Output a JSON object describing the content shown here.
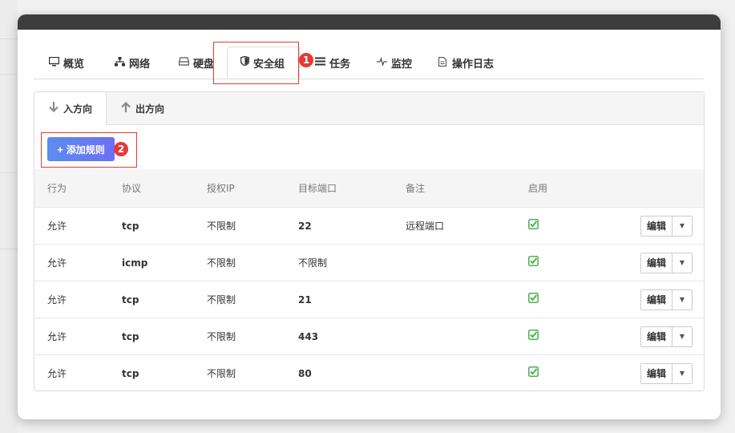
{
  "tabs": [
    {
      "label": "概览",
      "icon": "monitor-icon"
    },
    {
      "label": "网络",
      "icon": "network-icon"
    },
    {
      "label": "硬盘",
      "icon": "disk-icon"
    },
    {
      "label": "安全组",
      "icon": "shield-icon"
    },
    {
      "label": "任务",
      "icon": "list-icon"
    },
    {
      "label": "监控",
      "icon": "pulse-icon"
    },
    {
      "label": "操作日志",
      "icon": "document-icon"
    }
  ],
  "active_tab": "安全组",
  "annotations": {
    "first": "1",
    "second": "2"
  },
  "subtabs": [
    {
      "label": "入方向",
      "icon": "arrow-down-icon"
    },
    {
      "label": "出方向",
      "icon": "arrow-up-icon"
    }
  ],
  "add_rule_label": "添加规则",
  "table": {
    "headers": [
      "行为",
      "协议",
      "授权IP",
      "目标端口",
      "备注",
      "启用"
    ],
    "rows": [
      {
        "action": "允许",
        "protocol": "tcp",
        "ip": "不限制",
        "port": "22",
        "note": "远程端口",
        "enabled": true
      },
      {
        "action": "允许",
        "protocol": "icmp",
        "ip": "不限制",
        "port": "不限制",
        "note": "",
        "enabled": true
      },
      {
        "action": "允许",
        "protocol": "tcp",
        "ip": "不限制",
        "port": "21",
        "note": "",
        "enabled": true
      },
      {
        "action": "允许",
        "protocol": "tcp",
        "ip": "不限制",
        "port": "443",
        "note": "",
        "enabled": true
      },
      {
        "action": "允许",
        "protocol": "tcp",
        "ip": "不限制",
        "port": "80",
        "note": "",
        "enabled": true
      }
    ],
    "edit_label": "编辑"
  },
  "colors": {
    "accent": "#5b8def",
    "annotation_red": "#e53935",
    "enabled_green": "#4caf50"
  }
}
